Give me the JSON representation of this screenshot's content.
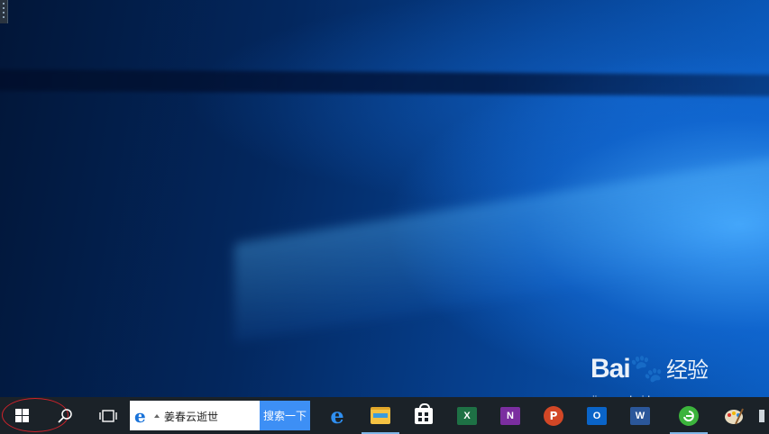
{
  "taskbar": {
    "search_box_text": "姜春云逝世",
    "search_button_label": "搜索一下",
    "apps": [
      {
        "name": "edge",
        "icon": "edge-icon"
      },
      {
        "name": "file-explorer",
        "icon": "folder-icon"
      },
      {
        "name": "store",
        "icon": "store-icon"
      },
      {
        "name": "excel",
        "icon": "excel-icon",
        "letter": "X",
        "color": "#1e7145"
      },
      {
        "name": "onenote",
        "icon": "onenote-icon",
        "letter": "N",
        "color": "#7b2ea0"
      },
      {
        "name": "powerpoint",
        "icon": "powerpoint-icon",
        "letter": "P",
        "color": "#d24726"
      },
      {
        "name": "outlook",
        "icon": "outlook-icon",
        "letter": "O",
        "color": "#0a64c8"
      },
      {
        "name": "word",
        "icon": "word-icon",
        "letter": "W",
        "color": "#2b579a"
      },
      {
        "name": "browser-360",
        "icon": "green-browser-icon",
        "color": "#3cb43c"
      },
      {
        "name": "paint",
        "icon": "palette-icon"
      }
    ]
  },
  "watermark": {
    "logo": "Bai",
    "logo_suffix": "经验",
    "url": "jingyan.baidu.com"
  },
  "colors": {
    "taskbar": "#1b2228",
    "search_button": "#3d8ff5",
    "start_highlight": "#d0222b"
  }
}
